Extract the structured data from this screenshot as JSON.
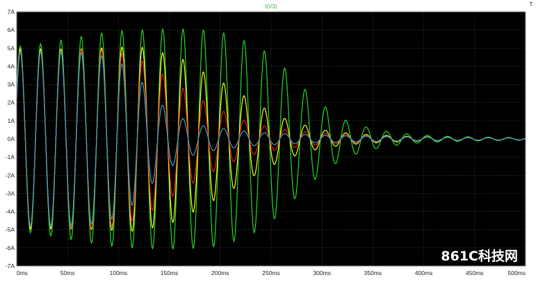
{
  "chart_data": {
    "type": "line",
    "title": "I(V3)",
    "xlabel": "",
    "ylabel": "",
    "xlim": [
      0,
      500
    ],
    "ylim": [
      -7,
      7
    ],
    "x_ticks": [
      "0ms",
      "50ms",
      "100ms",
      "150ms",
      "200ms",
      "250ms",
      "300ms",
      "350ms",
      "400ms",
      "450ms",
      "500ms"
    ],
    "y_ticks": [
      "7A",
      "6A",
      "5A",
      "4A",
      "3A",
      "2A",
      "1A",
      "0A",
      "-1A",
      "-2A",
      "-3A",
      "-4A",
      "-5A",
      "-6A",
      "-7A"
    ],
    "grid": true,
    "background": "#000000",
    "period_ms": 20,
    "series": [
      {
        "color": "#22dd22",
        "peaks": [
          [
            0,
            5.1
          ],
          [
            20,
            5.2
          ],
          [
            40,
            5.4
          ],
          [
            60,
            5.6
          ],
          [
            80,
            5.8
          ],
          [
            100,
            5.95
          ],
          [
            120,
            6.0
          ],
          [
            140,
            6.05
          ],
          [
            160,
            6.05
          ],
          [
            180,
            6.0
          ],
          [
            200,
            5.9
          ],
          [
            220,
            5.5
          ],
          [
            240,
            5.0
          ],
          [
            260,
            4.1
          ],
          [
            280,
            2.9
          ],
          [
            300,
            1.9
          ],
          [
            320,
            1.1
          ],
          [
            340,
            0.7
          ],
          [
            360,
            0.45
          ],
          [
            380,
            0.3
          ],
          [
            400,
            0.2
          ],
          [
            420,
            0.15
          ],
          [
            440,
            0.12
          ],
          [
            460,
            0.1
          ],
          [
            480,
            0.08
          ],
          [
            500,
            0.06
          ]
        ]
      },
      {
        "color": "#ffff22",
        "peaks": [
          [
            0,
            4.95
          ],
          [
            20,
            4.95
          ],
          [
            40,
            4.95
          ],
          [
            60,
            4.95
          ],
          [
            80,
            5.0
          ],
          [
            100,
            5.05
          ],
          [
            120,
            5.1
          ],
          [
            140,
            4.8
          ],
          [
            160,
            4.5
          ],
          [
            180,
            3.8
          ],
          [
            200,
            3.2
          ],
          [
            220,
            2.5
          ],
          [
            240,
            1.8
          ],
          [
            260,
            1.2
          ],
          [
            280,
            0.8
          ],
          [
            300,
            0.5
          ],
          [
            320,
            0.35
          ],
          [
            340,
            0.25
          ],
          [
            360,
            0.2
          ],
          [
            380,
            0.15
          ],
          [
            400,
            0.12
          ],
          [
            420,
            0.1
          ],
          [
            440,
            0.09
          ],
          [
            460,
            0.08
          ],
          [
            480,
            0.07
          ],
          [
            500,
            0.06
          ]
        ]
      },
      {
        "color": "#ee2222",
        "peaks": [
          [
            0,
            4.85
          ],
          [
            20,
            4.85
          ],
          [
            40,
            4.85
          ],
          [
            60,
            4.9
          ],
          [
            80,
            4.9
          ],
          [
            100,
            4.75
          ],
          [
            120,
            4.4
          ],
          [
            140,
            3.7
          ],
          [
            160,
            2.9
          ],
          [
            180,
            2.2
          ],
          [
            200,
            1.6
          ],
          [
            220,
            1.1
          ],
          [
            240,
            0.75
          ],
          [
            260,
            0.55
          ],
          [
            280,
            0.4
          ],
          [
            300,
            0.3
          ],
          [
            320,
            0.25
          ],
          [
            340,
            0.2
          ],
          [
            360,
            0.15
          ],
          [
            380,
            0.12
          ],
          [
            400,
            0.1
          ],
          [
            420,
            0.09
          ],
          [
            440,
            0.08
          ],
          [
            460,
            0.07
          ],
          [
            480,
            0.06
          ],
          [
            500,
            0.05
          ]
        ]
      },
      {
        "color": "#3aa6c8",
        "peaks": [
          [
            0,
            4.8
          ],
          [
            20,
            4.8
          ],
          [
            40,
            4.8
          ],
          [
            60,
            4.75
          ],
          [
            80,
            4.65
          ],
          [
            100,
            4.3
          ],
          [
            120,
            3.35
          ],
          [
            140,
            2.0
          ],
          [
            160,
            1.2
          ],
          [
            180,
            0.75
          ],
          [
            200,
            0.6
          ],
          [
            220,
            0.45
          ],
          [
            240,
            0.35
          ],
          [
            260,
            0.3
          ],
          [
            280,
            0.25
          ],
          [
            300,
            0.2
          ],
          [
            320,
            0.17
          ],
          [
            340,
            0.15
          ],
          [
            360,
            0.13
          ],
          [
            380,
            0.11
          ],
          [
            400,
            0.1
          ],
          [
            420,
            0.09
          ],
          [
            440,
            0.08
          ],
          [
            460,
            0.07
          ],
          [
            480,
            0.06
          ],
          [
            500,
            0.05
          ]
        ]
      }
    ]
  },
  "watermark": "861C科技网",
  "corner_mark": "T"
}
